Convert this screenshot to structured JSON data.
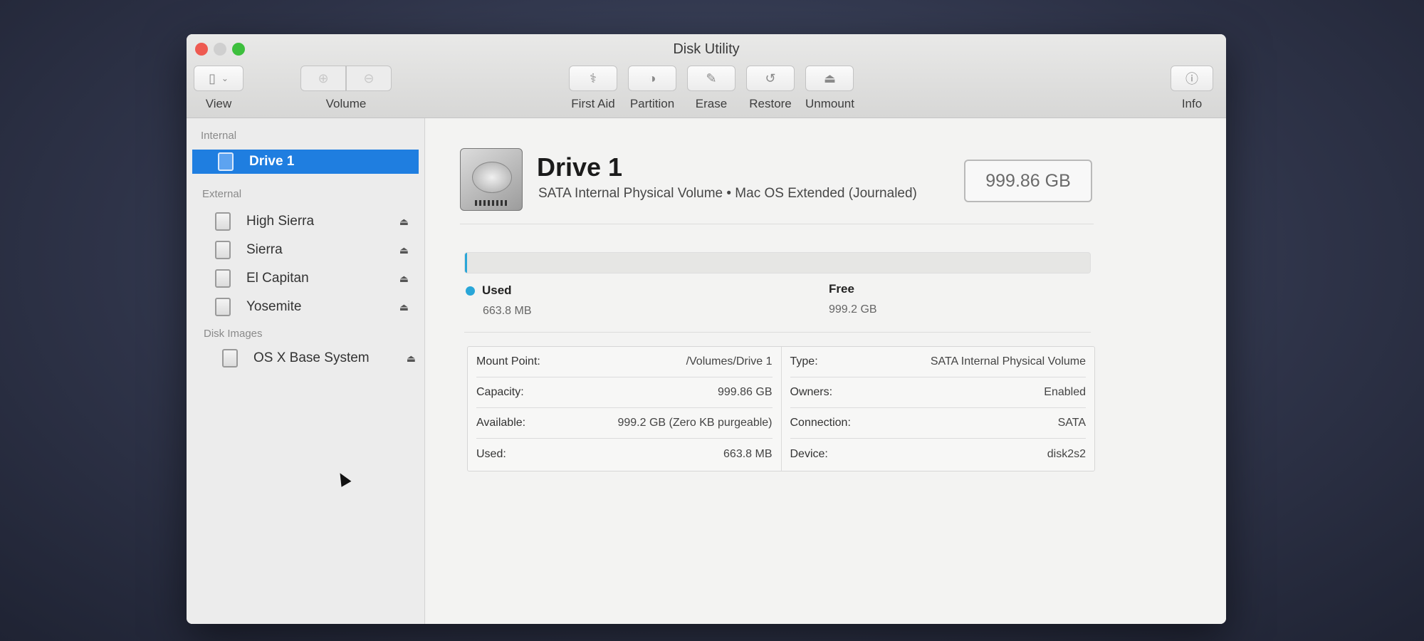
{
  "window": {
    "title": "Disk Utility"
  },
  "toolbar": {
    "view_label": "View",
    "volume_label": "Volume",
    "first_aid": "First Aid",
    "partition": "Partition",
    "erase": "Erase",
    "restore": "Restore",
    "unmount": "Unmount",
    "info": "Info"
  },
  "sidebar": {
    "internal_header": "Internal",
    "internal_items": [
      {
        "label": "Drive 1"
      }
    ],
    "external_header": "External",
    "external_items": [
      {
        "label": "High Sierra"
      },
      {
        "label": "Sierra"
      },
      {
        "label": "El Capitan"
      },
      {
        "label": "Yosemite"
      }
    ],
    "images_header": "Disk Images",
    "image_items": [
      {
        "label": "OS X Base System"
      }
    ]
  },
  "detail": {
    "name": "Drive 1",
    "subtitle": "SATA Internal Physical Volume • Mac OS Extended (Journaled)",
    "capacity_badge": "999.86 GB",
    "used_fraction": 0.00066,
    "used_color": "#29a6d8",
    "used_title": "Used",
    "used_value": "663.8 MB",
    "free_title": "Free",
    "free_value": "999.2 GB"
  },
  "info": {
    "left": [
      {
        "label": "Mount Point:",
        "value": "/Volumes/Drive 1"
      },
      {
        "label": "Capacity:",
        "value": "999.86 GB"
      },
      {
        "label": "Available:",
        "value": "999.2 GB (Zero KB purgeable)"
      },
      {
        "label": "Used:",
        "value": "663.8 MB"
      }
    ],
    "right": [
      {
        "label": "Type:",
        "value": "SATA Internal Physical Volume"
      },
      {
        "label": "Owners:",
        "value": "Enabled"
      },
      {
        "label": "Connection:",
        "value": "SATA"
      },
      {
        "label": "Device:",
        "value": "disk2s2"
      }
    ]
  }
}
